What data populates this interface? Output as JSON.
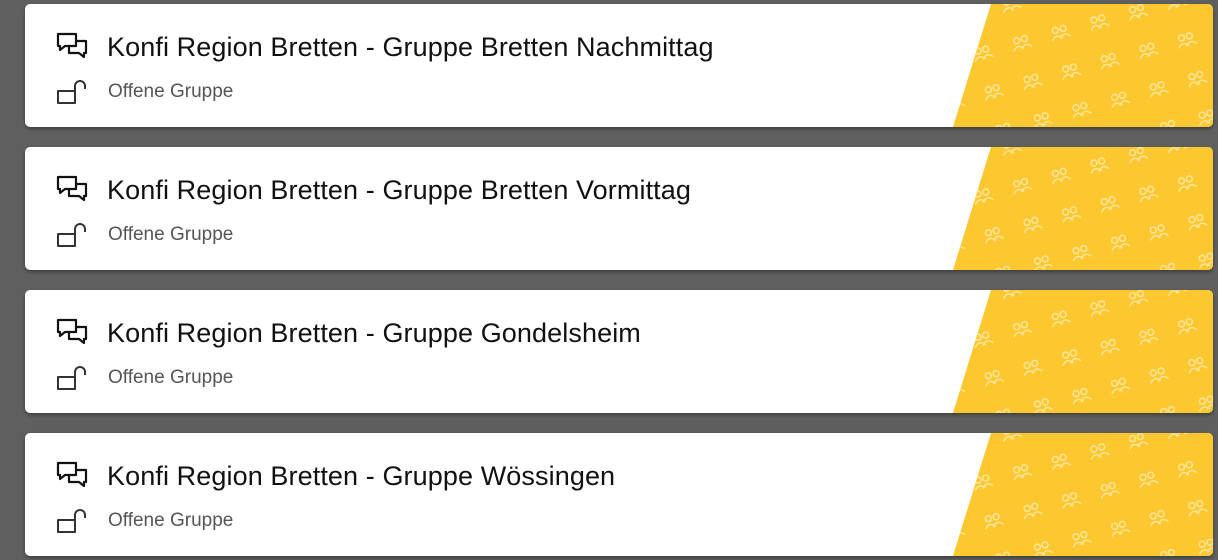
{
  "theme": {
    "background": "#5f5f5f",
    "card_background": "#ffffff",
    "banner_color": "#fcc72f",
    "title_color": "#111111",
    "subtitle_color": "#555555"
  },
  "groups": [
    {
      "title": "Konfi Region Bretten - Gruppe Bretten Nachmittag",
      "type_label": "Offene Gruppe",
      "icon": "chat-bubbles-icon",
      "status_icon": "unlocked-icon"
    },
    {
      "title": "Konfi Region Bretten - Gruppe Bretten Vormittag",
      "type_label": "Offene Gruppe",
      "icon": "chat-bubbles-icon",
      "status_icon": "unlocked-icon"
    },
    {
      "title": "Konfi Region Bretten - Gruppe Gondelsheim",
      "type_label": "Offene Gruppe",
      "icon": "chat-bubbles-icon",
      "status_icon": "unlocked-icon"
    },
    {
      "title": "Konfi Region Bretten - Gruppe Wössingen",
      "type_label": "Offene Gruppe",
      "icon": "chat-bubbles-icon",
      "status_icon": "unlocked-icon"
    }
  ]
}
